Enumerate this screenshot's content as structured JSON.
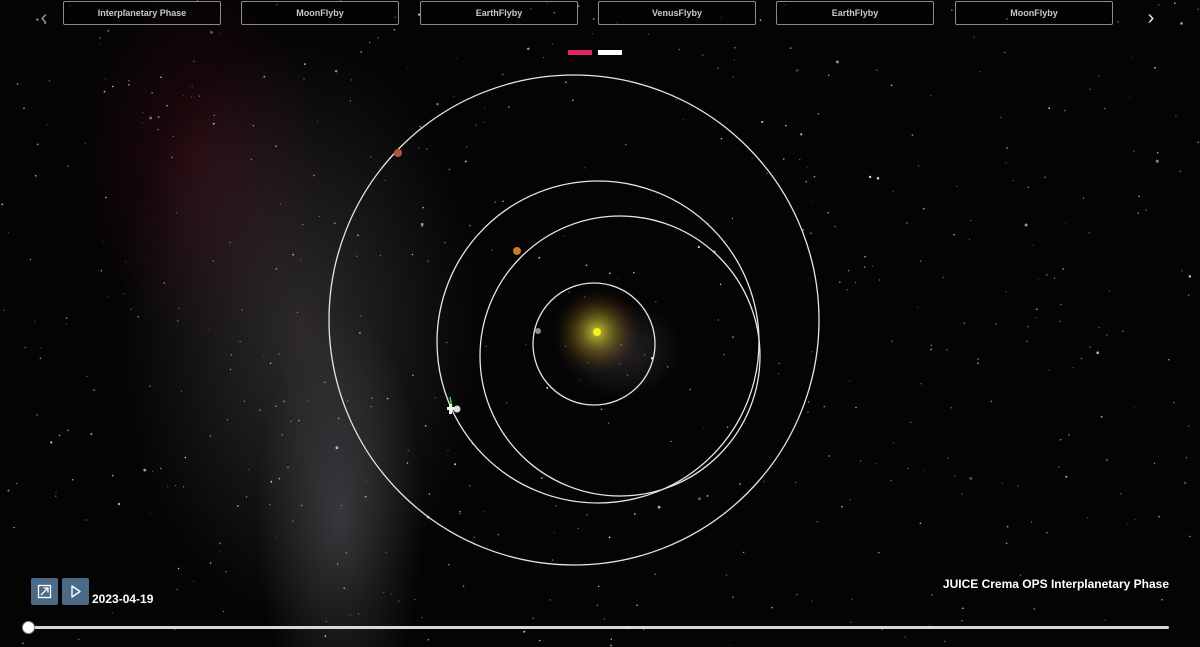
{
  "navigation": {
    "prev_symbol": "‹",
    "next_symbol": "›",
    "phases": [
      {
        "label": "Interplanetary Phase"
      },
      {
        "label": "MoonFlyby"
      },
      {
        "label": "EarthFlyby"
      },
      {
        "label": "VenusFlyby"
      },
      {
        "label": "EarthFlyby"
      },
      {
        "label": "MoonFlyby"
      }
    ]
  },
  "indicators": [
    {
      "color": "#e0245e",
      "active": true
    },
    {
      "color": "#ffffff",
      "active": false
    }
  ],
  "controls": {
    "expand_icon": "expand-icon",
    "play_icon": "play-icon",
    "date": "2023-04-19"
  },
  "mission": {
    "title": "JUICE Crema OPS Interplanetary Phase"
  },
  "timeline": {
    "progress": 0.0
  },
  "scene": {
    "sun_color": "#f2f21a",
    "orbit_color": "#e6e6e6",
    "bodies": [
      {
        "name": "mercury",
        "color": "#8e8e8e"
      },
      {
        "name": "venus",
        "color": "#c97a2a"
      },
      {
        "name": "mars",
        "color": "#b0553a"
      },
      {
        "name": "spacecraft",
        "color": "#dddddd"
      }
    ]
  }
}
